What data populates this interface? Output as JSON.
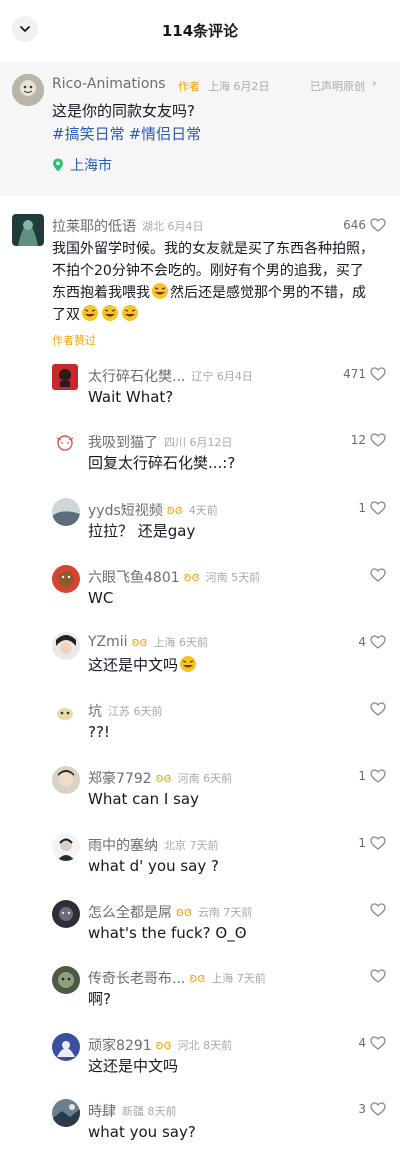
{
  "header": {
    "title": "114条评论"
  },
  "post": {
    "author": "Rico-Animations",
    "author_tag": "作者",
    "meta": "上海 6月2日",
    "declare": "已声明原创",
    "text": "这是你的同款女友吗?",
    "tags": [
      "#搞笑日常",
      "#情侣日常"
    ],
    "location": "上海市"
  },
  "comments": [
    {
      "name": "拉莱耶的低语",
      "meta": "湖北 6月4日",
      "likes": "646",
      "text_lines": [
        "我国外留学时候。我的女友就是买了东西各种拍照，",
        "不拍个20分钟不会吃的。刚好有个男的追我，买了",
        "东西抱着我喂我",
        "然后还是感觉那个男的不错，成",
        "了双"
      ],
      "author_liked": "作者赞过"
    },
    {
      "name": "太行碎石化樊...",
      "meta": "辽宁 6月4日",
      "likes": "471",
      "text": "Wait What?"
    },
    {
      "name": "我吸到猫了",
      "meta": "四川 6月12日",
      "likes": "12",
      "text": "回复太行碎石化樊...:?"
    },
    {
      "name": "yyds短视频",
      "meta": "4天前",
      "likes": "1",
      "text": "拉拉？ 还是gay"
    },
    {
      "name": "六眼飞鱼4801",
      "meta": "河南 5天前",
      "likes": "",
      "text": "WC"
    },
    {
      "name": "YZmii",
      "meta": "上海 6天前",
      "likes": "4",
      "text": "这还是中文吗"
    },
    {
      "name": "坑",
      "meta": "江苏 6天前",
      "likes": "",
      "text": "??!"
    },
    {
      "name": "郑豪7792",
      "meta": "河南 6天前",
      "likes": "1",
      "text": "What can I say"
    },
    {
      "name": "雨中的塞纳",
      "meta": "北京 7天前",
      "likes": "1",
      "text": "what d' you say ?"
    },
    {
      "name": "怎么全都是屌",
      "meta": "云南 7天前",
      "likes": "",
      "text": "what's the fuck? ʘ_ʘ"
    },
    {
      "name": "传奇长老哥布...",
      "meta": "上海 7天前",
      "likes": "",
      "text": "啊?"
    },
    {
      "name": "顽家8291",
      "meta": "河北 8天前",
      "likes": "4",
      "text": "这还是中文吗"
    },
    {
      "name": "時肆",
      "meta": "新疆 8天前",
      "likes": "3",
      "text": "what you say?"
    }
  ],
  "colors": {
    "accent_blue": "#2a5bb8",
    "author_orange": "#f6a500",
    "meta_gray": "#a8a9ae"
  }
}
